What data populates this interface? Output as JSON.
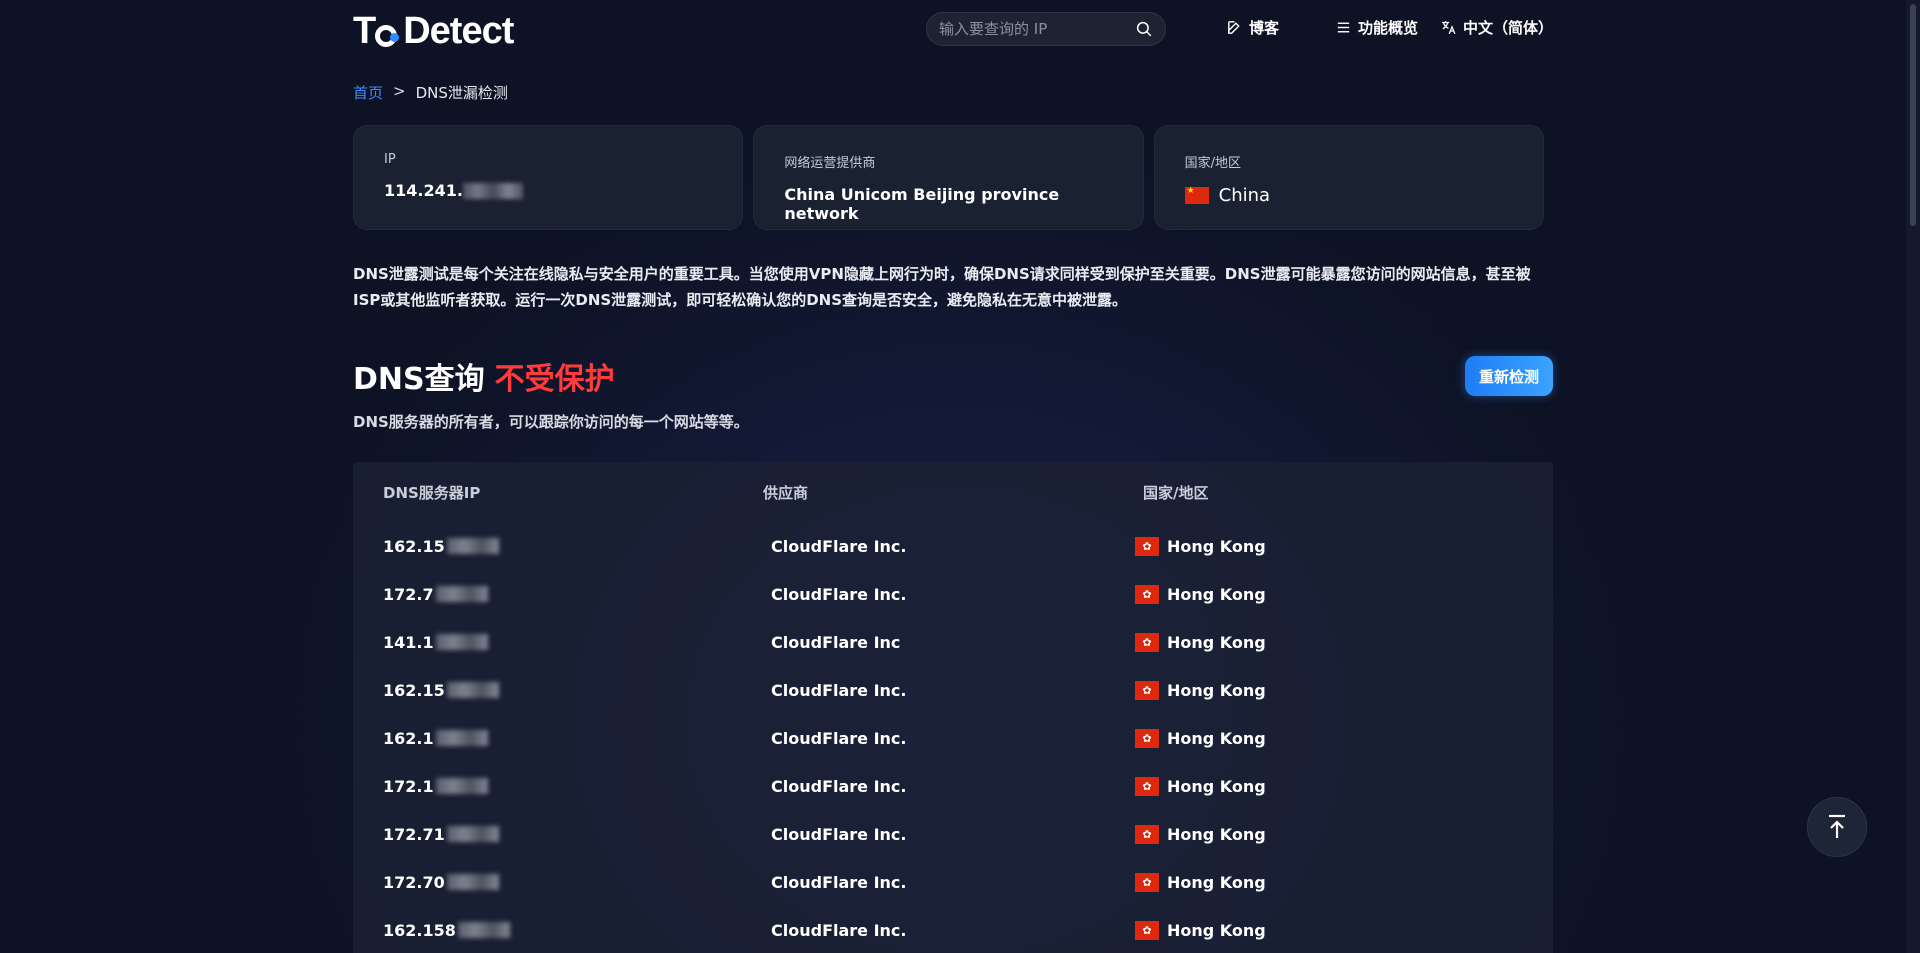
{
  "header": {
    "logo": {
      "part1": "T",
      "part2": "Detect"
    },
    "search_placeholder": "输入要查询的 IP",
    "nav": {
      "blog": "博客",
      "features": "功能概览",
      "language": "中文（简体）"
    }
  },
  "breadcrumb": {
    "home": "首页",
    "separator": ">",
    "current": "DNS泄漏检测"
  },
  "cards": {
    "ip": {
      "label": "IP",
      "value": "114.241."
    },
    "isp": {
      "label": "网络运营提供商",
      "value": "China Unicom Beijing province network"
    },
    "country": {
      "label": "国家/地区",
      "value": "China"
    }
  },
  "intro": "DNS泄露测试是每个关注在线隐私与安全用户的重要工具。当您使用VPN隐藏上网行为时，确保DNS请求同样受到保护至关重要。DNS泄露可能暴露您访问的网站信息，甚至被ISP或其他监听者获取。运行一次DNS泄露测试，即可轻松确认您的DNS查询是否安全，避免隐私在无意中被泄露。",
  "dns_section": {
    "title": "DNS查询",
    "status": "不受保护",
    "subtitle": "DNS服务器的所有者，可以跟踪你访问的每一个网站等等。",
    "retest_button": "重新检测"
  },
  "table": {
    "headers": [
      "DNS服务器IP",
      "供应商",
      "国家/地区"
    ],
    "rows": [
      {
        "ip": "162.15",
        "provider": "CloudFlare Inc.",
        "country": "Hong Kong"
      },
      {
        "ip": "172.7",
        "provider": "CloudFlare Inc.",
        "country": "Hong Kong"
      },
      {
        "ip": "141.1",
        "provider": "CloudFlare Inc",
        "country": "Hong Kong"
      },
      {
        "ip": "162.15",
        "provider": "CloudFlare Inc.",
        "country": "Hong Kong"
      },
      {
        "ip": "162.1",
        "provider": "CloudFlare Inc.",
        "country": "Hong Kong"
      },
      {
        "ip": "172.1",
        "provider": "CloudFlare Inc.",
        "country": "Hong Kong"
      },
      {
        "ip": "172.71",
        "provider": "CloudFlare Inc.",
        "country": "Hong Kong"
      },
      {
        "ip": "172.70",
        "provider": "CloudFlare Inc.",
        "country": "Hong Kong"
      },
      {
        "ip": "162.158",
        "provider": "CloudFlare Inc.",
        "country": "Hong Kong"
      }
    ]
  },
  "colors": {
    "accent": "#2f8bff",
    "danger": "#ff3b3b",
    "background": "#0d1224",
    "card": "#1a2131"
  },
  "icons": [
    "search-icon",
    "edit-icon",
    "menu-icon",
    "translate-icon",
    "cn-flag-icon",
    "hk-flag-icon",
    "arrow-up-icon"
  ]
}
